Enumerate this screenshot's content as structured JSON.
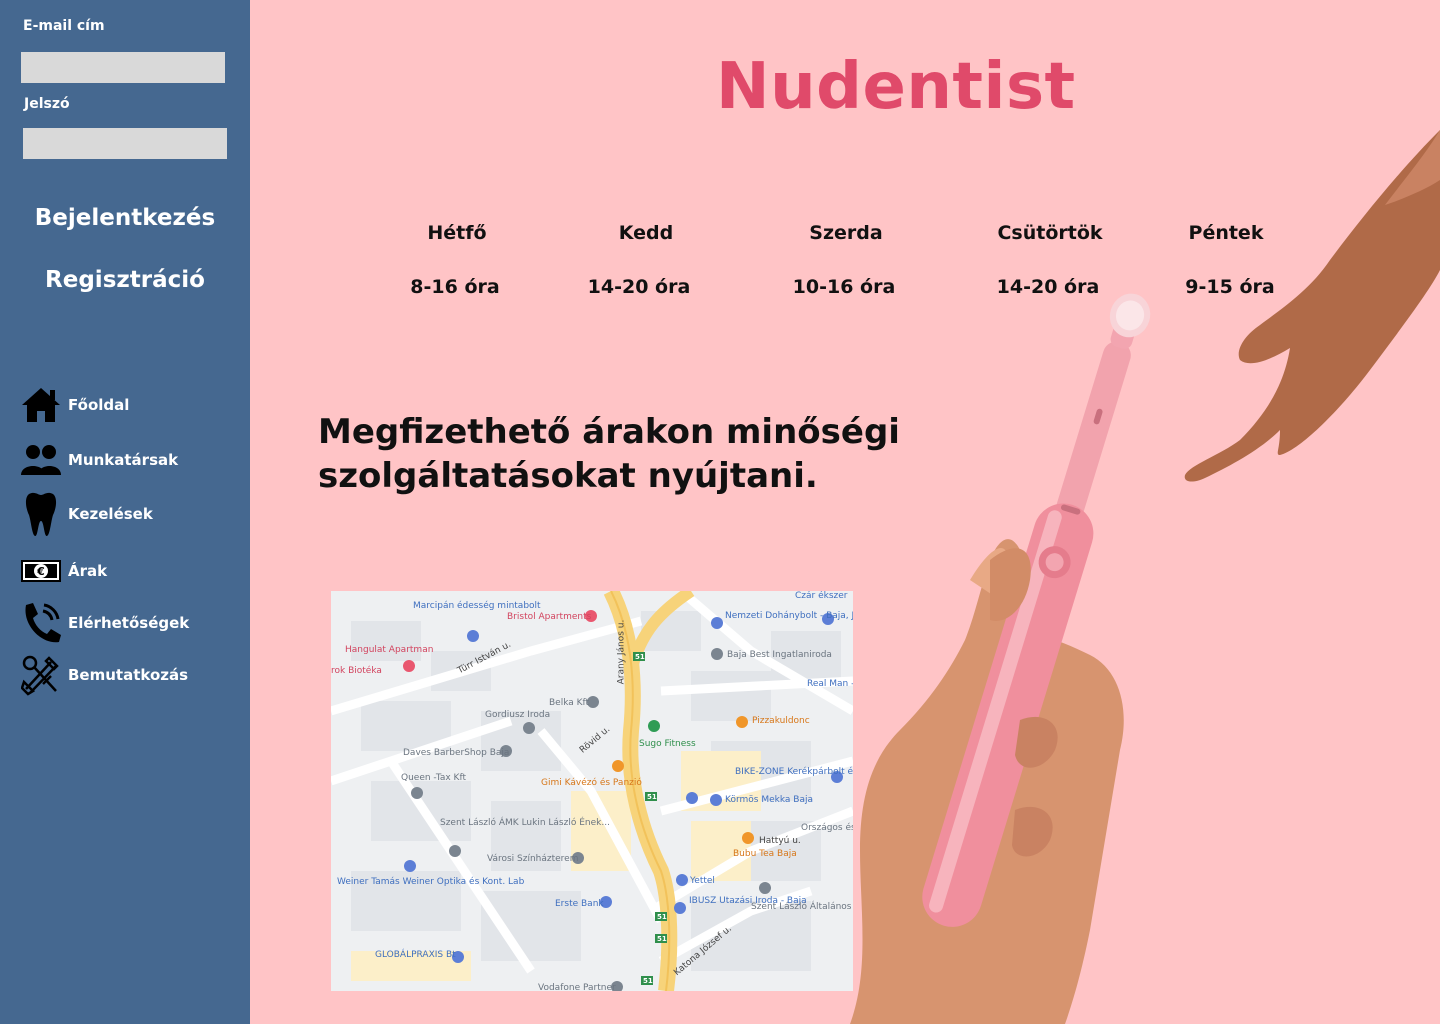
{
  "sidebar": {
    "email_label": "E-mail cím",
    "email_value": "",
    "password_label": "Jelszó",
    "password_value": "",
    "login_label": "Bejelentkezés",
    "register_label": "Regisztráció",
    "nav": [
      {
        "label": "Főoldal",
        "icon": "home-icon"
      },
      {
        "label": "Munkatársak",
        "icon": "users-icon"
      },
      {
        "label": "Kezelések",
        "icon": "tooth-icon"
      },
      {
        "label": "Árak",
        "icon": "euro-banknote-icon"
      },
      {
        "label": "Elérhetőségek",
        "icon": "phone-icon"
      },
      {
        "label": "Bemutatkozás",
        "icon": "tools-icon"
      }
    ]
  },
  "brand": {
    "title": "Nudentist",
    "color": "#e04a6a"
  },
  "schedule": [
    {
      "day": "Hétfő",
      "hours": "8-16 óra"
    },
    {
      "day": "Kedd",
      "hours": "14-20 óra"
    },
    {
      "day": "Szerda",
      "hours": "10-16 óra"
    },
    {
      "day": "Csütörtök",
      "hours": "14-20 óra"
    },
    {
      "day": "Péntek",
      "hours": "9-15 óra"
    }
  ],
  "tagline": "Megfizethető árakon minőségi szolgáltatásokat nyújtani.",
  "map": {
    "labels": [
      "Marcipán édesség mintabolt",
      "Bristol Apartments",
      "Czár ékszer",
      "Nemzeti Dohánybolt - Baja, Jelky András tér",
      "Hangulat Apartman",
      "Baja Best Ingatlaniroda",
      "rok Biotéka",
      "Türr István u.",
      "Arany János u.",
      "Real Man - ruházat és",
      "Belka Kft",
      "Gordiusz Iroda",
      "Pizzakuldonc",
      "Sugo Fitness",
      "Daves BarberShop Baja",
      "Rövid u.",
      "BIKE-ZONE Kerékpárbolt és Szerviz",
      "Queen -Tax Kft",
      "Gimi Kávézó és Panzió",
      "Körmös Mekka Baja",
      "Szent László ÁMK Lukin László Ének...",
      "Hattyú u.",
      "Bubu Tea Baja",
      "Városi Színházterem",
      "Weiner Tamás Weiner Optika és Kont. Lab",
      "Yettel",
      "Erste Bank",
      "IBUSZ Utazási Iroda - Baja",
      "Szent László Általános Művelődési Központ",
      "Katona József u.",
      "GLOBÁLPRAXIS Bt",
      "Vodafone Partner",
      "Országos és Fordítás"
    ]
  },
  "colors": {
    "sidebar": "#456890",
    "background": "#ffc4c6",
    "brand": "#e04a6a",
    "input": "#d9d9d9"
  }
}
